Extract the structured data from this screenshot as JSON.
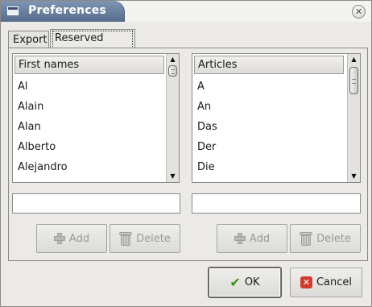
{
  "window": {
    "title": "Preferences"
  },
  "tabs": [
    {
      "label": "Export",
      "active": false
    },
    {
      "label": "Reserved words",
      "active": true
    }
  ],
  "left_list": {
    "header": "First names",
    "items": [
      "Al",
      "Alain",
      "Alan",
      "Alberto",
      "Alejandro"
    ],
    "input_value": "",
    "add_label": "Add",
    "delete_label": "Delete",
    "add_enabled": false,
    "delete_enabled": false
  },
  "right_list": {
    "header": "Articles",
    "items": [
      "A",
      "An",
      "Das",
      "Der",
      "Die"
    ],
    "input_value": "",
    "add_label": "Add",
    "delete_label": "Delete",
    "add_enabled": false,
    "delete_enabled": false
  },
  "dialog_buttons": {
    "ok_label": "OK",
    "cancel_label": "Cancel"
  },
  "icons": {
    "window": "window-icon",
    "close": "close-icon",
    "add": "plus-icon",
    "delete": "trash-icon",
    "ok": "checkmark-icon",
    "cancel": "cancel-x-icon"
  },
  "colors": {
    "titlebar": "#6b80a0",
    "ok_check": "#3c8f22",
    "cancel_x": "#cf3b30"
  }
}
